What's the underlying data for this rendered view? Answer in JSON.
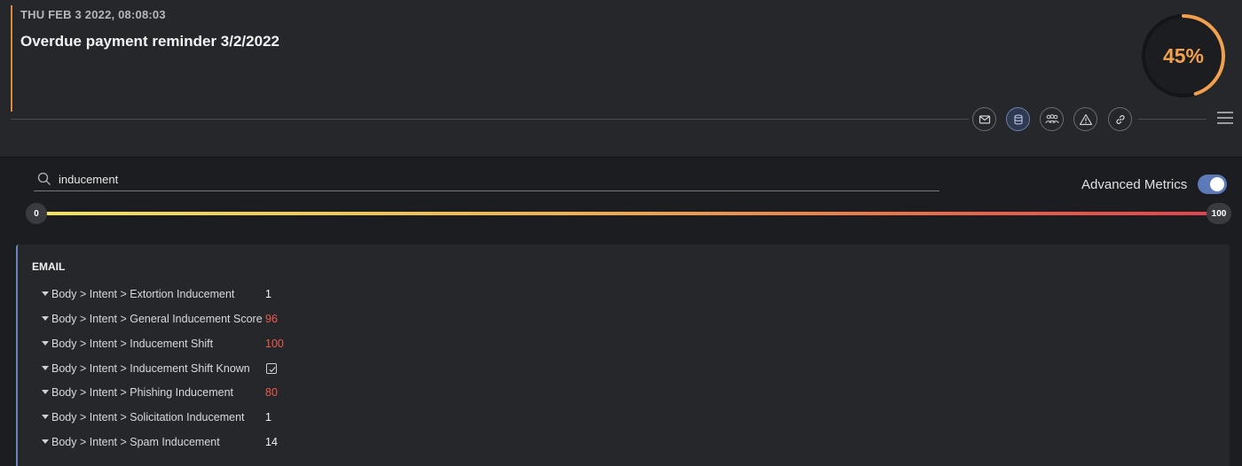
{
  "header": {
    "date": "THU FEB 3 2022, 08:08:03",
    "title": "Overdue payment reminder 3/2/2022",
    "score_label": "45%",
    "score_value": 45,
    "accent_color": "#d9893b",
    "gauge_color": "#f2a04e",
    "action_icons": [
      "envelope-icon",
      "database-icon",
      "users-icon",
      "warning-icon",
      "link-icon"
    ],
    "menu_icon": "hamburger-menu-icon"
  },
  "search": {
    "value": "inducement",
    "icon": "search-icon"
  },
  "advanced_metrics": {
    "label": "Advanced Metrics",
    "enabled": true,
    "toggle_color": "#5d7ab8"
  },
  "range_slider": {
    "min_label": "0",
    "max_label": "100"
  },
  "panel": {
    "title": "EMAIL",
    "rows": [
      {
        "label": "Body > Intent > Extortion Inducement",
        "value": "1",
        "hot": false
      },
      {
        "label": "Body > Intent > General Inducement Score",
        "value": "96",
        "hot": true
      },
      {
        "label": "Body > Intent > Inducement Shift",
        "value": "100",
        "hot": true
      },
      {
        "label": "Body > Intent > Inducement Shift Known",
        "value": "",
        "checked": true
      },
      {
        "label": "Body > Intent > Phishing Inducement",
        "value": "80",
        "hot": true
      },
      {
        "label": "Body > Intent > Solicitation Inducement",
        "value": "1",
        "hot": false
      },
      {
        "label": "Body > Intent > Spam Inducement",
        "value": "14",
        "hot": false
      }
    ],
    "hot_color": "#ef5a4b"
  }
}
